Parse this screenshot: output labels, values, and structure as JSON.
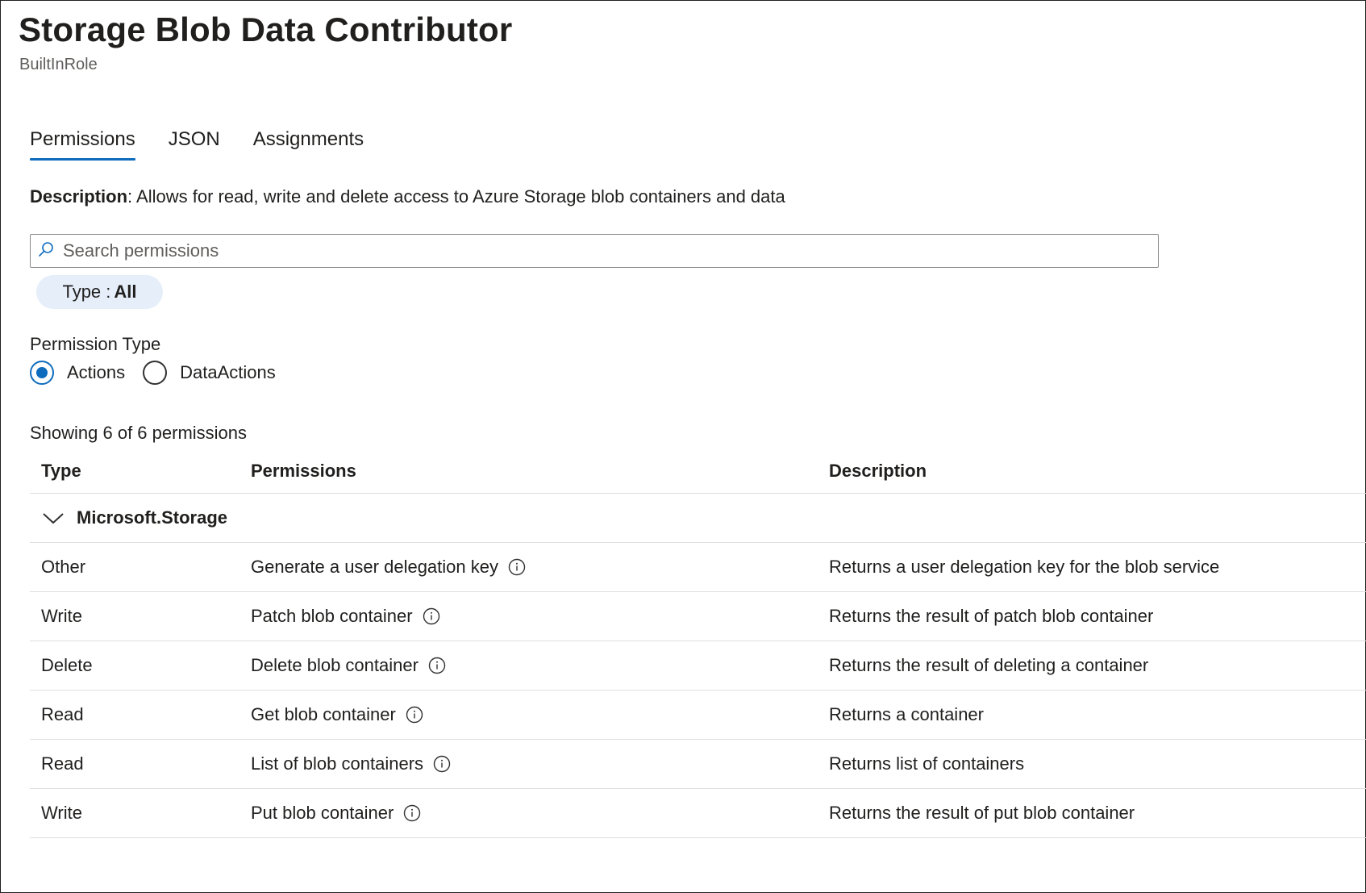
{
  "page": {
    "title": "Storage Blob Data Contributor",
    "subtitle": "BuiltInRole"
  },
  "tabs": [
    {
      "label": "Permissions",
      "active": true
    },
    {
      "label": "JSON",
      "active": false
    },
    {
      "label": "Assignments",
      "active": false
    }
  ],
  "description": {
    "label": "Description",
    "text": ": Allows for read, write and delete access to Azure Storage blob containers and data"
  },
  "search": {
    "placeholder": "Search permissions",
    "value": ""
  },
  "filter": {
    "label": "Type : ",
    "value": "All"
  },
  "permission_type": {
    "label": "Permission Type",
    "options": [
      {
        "label": "Actions",
        "selected": true
      },
      {
        "label": "DataActions",
        "selected": false
      }
    ]
  },
  "results": {
    "showing": "Showing 6 of 6 permissions"
  },
  "table": {
    "columns": [
      "Type",
      "Permissions",
      "Description"
    ],
    "group": "Microsoft.Storage",
    "rows": [
      {
        "type": "Other",
        "permission": "Generate a user delegation key",
        "description": "Returns a user delegation key for the blob service"
      },
      {
        "type": "Write",
        "permission": "Patch blob container",
        "description": "Returns the result of patch blob container"
      },
      {
        "type": "Delete",
        "permission": "Delete blob container",
        "description": "Returns the result of deleting a container"
      },
      {
        "type": "Read",
        "permission": "Get blob container",
        "description": "Returns a container"
      },
      {
        "type": "Read",
        "permission": "List of blob containers",
        "description": "Returns list of containers"
      },
      {
        "type": "Write",
        "permission": "Put blob container",
        "description": "Returns the result of put blob container"
      }
    ]
  },
  "colors": {
    "accent": "#0f6cbd",
    "pill_bg": "#e6eefa",
    "border": "#e1dfdd"
  },
  "icons": {
    "search": "search-icon",
    "chevron": "chevron-down-icon",
    "info": "info-icon"
  }
}
